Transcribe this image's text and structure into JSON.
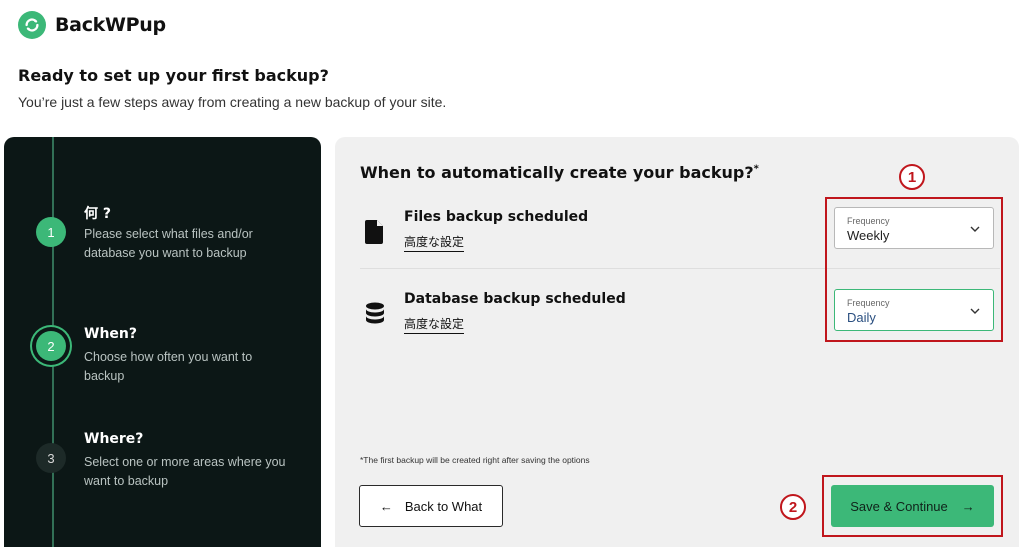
{
  "brand": {
    "name": "BackWPup"
  },
  "header": {
    "title": "Ready to set up your first backup?",
    "subtitle": "You’re just a few steps away from creating a new backup of your site."
  },
  "steps": [
    {
      "number": "1",
      "title": "何 ?",
      "description": "Please select what files and/or database you want to backup",
      "state": "done"
    },
    {
      "number": "2",
      "title": "When?",
      "description": "Choose how often you want to backup",
      "state": "active"
    },
    {
      "number": "3",
      "title": "Where?",
      "description": "Select one or more areas where you want to backup",
      "state": "todo"
    }
  ],
  "panel": {
    "heading": "When to automatically create your backup?",
    "heading_mark": "*",
    "rows": [
      {
        "title": "Files backup scheduled",
        "link": "高度な設定",
        "icon": "file-icon",
        "frequency_label": "Frequency",
        "frequency_value": "Weekly"
      },
      {
        "title": "Database backup scheduled",
        "link": "高度な設定",
        "icon": "database-icon",
        "frequency_label": "Frequency",
        "frequency_value": "Daily"
      }
    ],
    "note": "*The first backup will be created right after saving the options",
    "back_button": {
      "label": "Back to What",
      "arrow": "←"
    },
    "save_button": {
      "label": "Save & Continue",
      "arrow": "→"
    }
  },
  "annotations": {
    "marker_1": "1",
    "marker_2": "2"
  },
  "colors": {
    "accent": "#3cb878",
    "dark_panel": "#0c1716",
    "annotation": "#c0161c"
  }
}
